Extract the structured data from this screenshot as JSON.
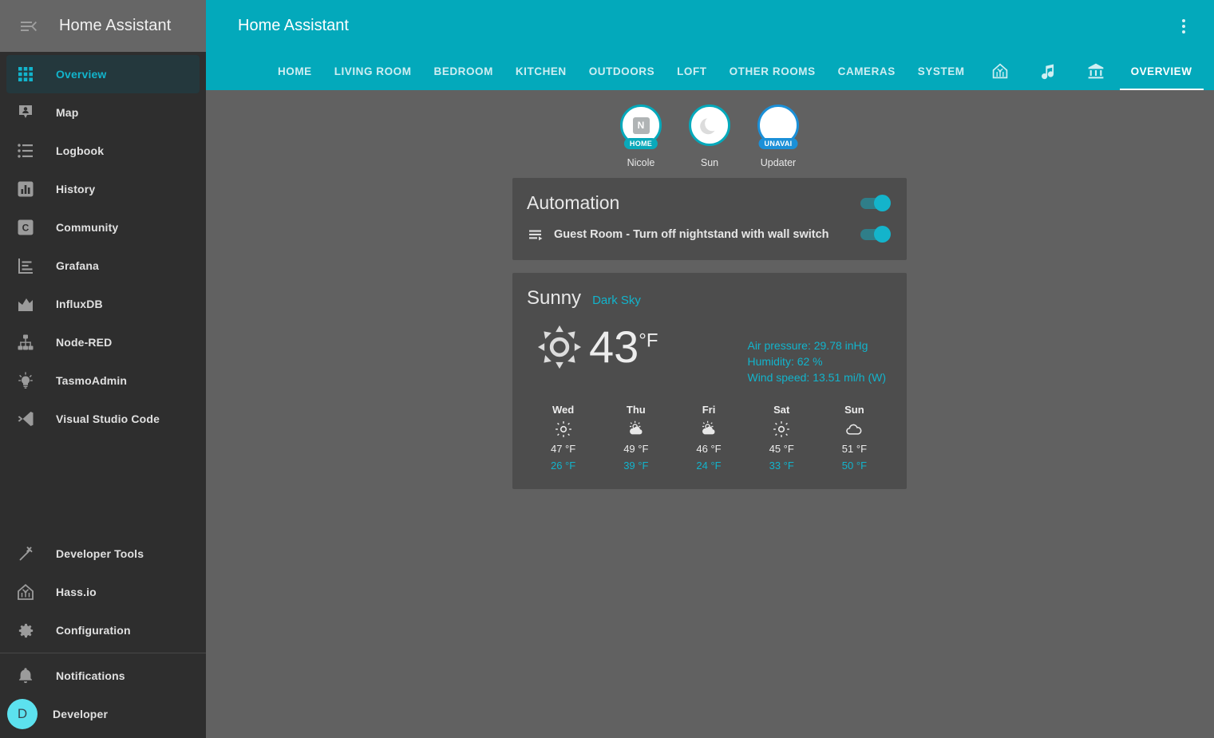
{
  "sidebar": {
    "title": "Home Assistant",
    "collapse_icon": "menu-collapse-icon",
    "items": [
      {
        "label": "Overview",
        "icon": "view-dashboard-icon",
        "active": true
      },
      {
        "label": "Map",
        "icon": "map-marker-account-icon",
        "active": false
      },
      {
        "label": "Logbook",
        "icon": "format-list-bulleted-icon",
        "active": false
      },
      {
        "label": "History",
        "icon": "chart-box-icon",
        "active": false
      },
      {
        "label": "Community",
        "icon": "community-c-icon",
        "active": false
      },
      {
        "label": "Grafana",
        "icon": "grafana-chart-icon",
        "active": false
      },
      {
        "label": "InfluxDB",
        "icon": "chart-line-icon",
        "active": false
      },
      {
        "label": "Node-RED",
        "icon": "sitemap-icon",
        "active": false
      },
      {
        "label": "TasmoAdmin",
        "icon": "lightbulb-on-icon",
        "active": false
      },
      {
        "label": "Visual Studio Code",
        "icon": "vscode-icon",
        "active": false
      }
    ],
    "bottom_items": [
      {
        "label": "Developer Tools",
        "icon": "hammer-icon"
      },
      {
        "label": "Hass.io",
        "icon": "hassio-home-icon"
      },
      {
        "label": "Configuration",
        "icon": "cog-icon"
      }
    ],
    "footer_items": [
      {
        "label": "Notifications",
        "icon": "bell-icon"
      },
      {
        "label": "Developer",
        "icon": "user-avatar",
        "avatar_initial": "D"
      }
    ]
  },
  "header": {
    "title": "Home Assistant",
    "overflow_menu_icon": "dots-vertical-icon",
    "accent_color": "#03a9bb"
  },
  "tabs": [
    {
      "label": "HOME",
      "type": "text",
      "active": false
    },
    {
      "label": "LIVING ROOM",
      "type": "text",
      "active": false
    },
    {
      "label": "BEDROOM",
      "type": "text",
      "active": false
    },
    {
      "label": "KITCHEN",
      "type": "text",
      "active": false
    },
    {
      "label": "OUTDOORS",
      "type": "text",
      "active": false
    },
    {
      "label": "LOFT",
      "type": "text",
      "active": false
    },
    {
      "label": "OTHER ROOMS",
      "type": "text",
      "active": false
    },
    {
      "label": "CAMERAS",
      "type": "text",
      "active": false
    },
    {
      "label": "SYSTEM",
      "type": "text",
      "active": false
    },
    {
      "label": "",
      "type": "icon",
      "icon": "home-automation-icon",
      "active": false
    },
    {
      "label": "",
      "type": "icon",
      "icon": "music-note-icon",
      "active": false
    },
    {
      "label": "",
      "type": "icon",
      "icon": "bank-icon",
      "active": false
    },
    {
      "label": "OVERVIEW",
      "type": "text",
      "active": true
    }
  ],
  "badges": [
    {
      "name": "Nicole",
      "state": "HOME",
      "icon": "person-initial-n",
      "initial": "N",
      "color": "#0aa9ba"
    },
    {
      "name": "Sun",
      "state": "",
      "icon": "moon-waning-crescent-icon",
      "color": "#03a9bb"
    },
    {
      "name": "Updater",
      "state": "UNAVAI",
      "icon": "blank-circle-icon",
      "color": "#1b90d8"
    }
  ],
  "automation_card": {
    "title": "Automation",
    "header_toggle_state": "on",
    "rows": [
      {
        "label": "Guest Room - Turn off nightstand with wall switch",
        "icon": "robot-playlist-icon",
        "toggle_state": "on"
      }
    ]
  },
  "weather_card": {
    "state": "Sunny",
    "source": "Dark Sky",
    "icon": "weather-sunny-icon",
    "temperature": "43",
    "unit": "°F",
    "attributes": [
      "Air pressure: 29.78 inHg",
      "Humidity: 62 %",
      "Wind speed: 13.51 mi/h (W)"
    ],
    "forecast": [
      {
        "day": "Wed",
        "icon": "weather-sunny-icon",
        "high": "47 °F",
        "low": "26 °F"
      },
      {
        "day": "Thu",
        "icon": "weather-partly-cloudy-icon",
        "high": "49 °F",
        "low": "39 °F"
      },
      {
        "day": "Fri",
        "icon": "weather-partly-cloudy-icon",
        "high": "46 °F",
        "low": "24 °F"
      },
      {
        "day": "Sat",
        "icon": "weather-sunny-icon",
        "high": "45 °F",
        "low": "33 °F"
      },
      {
        "day": "Sun",
        "icon": "weather-cloudy-icon",
        "high": "51 °F",
        "low": "50 °F"
      }
    ]
  }
}
